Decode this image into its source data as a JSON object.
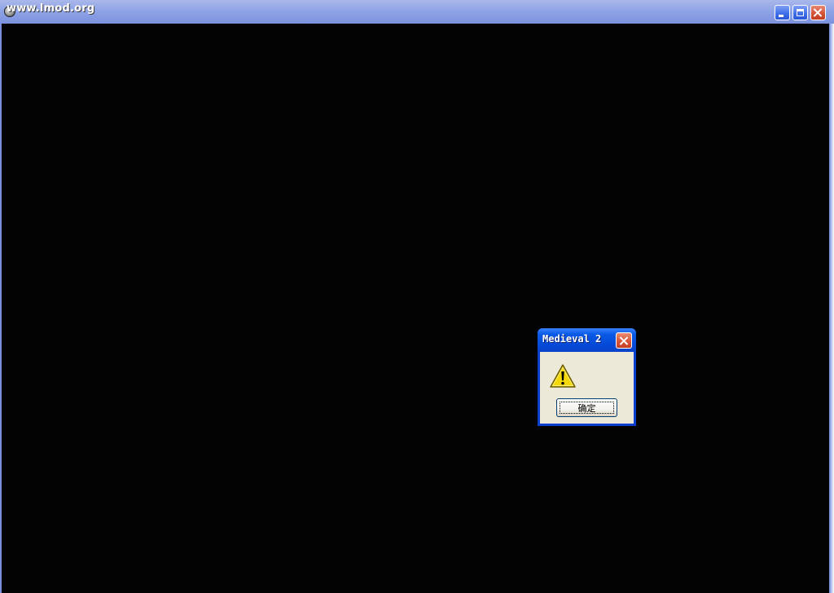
{
  "main_window": {
    "title": "www.lmod.org",
    "icon": "app-icon",
    "controls": {
      "minimize_icon": "minimize-icon",
      "maximize_icon": "maximize-icon",
      "close_icon": "close-icon"
    }
  },
  "dialog": {
    "title": "Medieval 2",
    "icon": "warning-icon",
    "message": "",
    "ok_label": "确定",
    "close_icon": "close-icon"
  },
  "colors": {
    "client_background": "#030303",
    "xp_titlebar_blue": "#0549d8",
    "inactive_titlebar": "#8fa3e6",
    "close_red": "#d4543a",
    "dialog_body": "#ece9d8",
    "warning_yellow": "#f5d80a"
  }
}
